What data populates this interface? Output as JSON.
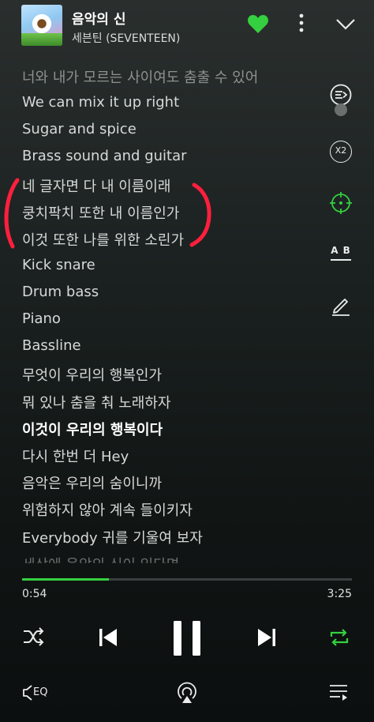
{
  "header": {
    "title": "음악의 신",
    "artist": "세븐틴 (SEVENTEEN)"
  },
  "lyrics": [
    {
      "text": "너와 내가 모르는 사이여도 춤출 수 있어",
      "state": "faded"
    },
    {
      "text": "We can mix it up right",
      "state": "normal"
    },
    {
      "text": "Sugar and spice",
      "state": "normal"
    },
    {
      "text": "Brass sound and guitar",
      "state": "normal"
    },
    {
      "text": "네 글자면 다 내 이름이래",
      "state": "normal"
    },
    {
      "text": "쿵치팍치 또한 내 이름인가",
      "state": "normal"
    },
    {
      "text": "이것 또한 나를 위한 소린가",
      "state": "normal"
    },
    {
      "text": "Kick snare",
      "state": "normal"
    },
    {
      "text": "Drum bass",
      "state": "normal"
    },
    {
      "text": "Piano",
      "state": "normal"
    },
    {
      "text": "Bassline",
      "state": "normal"
    },
    {
      "text": "무엇이 우리의 행복인가",
      "state": "normal"
    },
    {
      "text": "뭐 있나 춤을 춰 노래하자",
      "state": "normal"
    },
    {
      "text": "이것이 우리의 행복이다",
      "state": "active"
    },
    {
      "text": "다시 한번 더 Hey",
      "state": "normal"
    },
    {
      "text": "음악은 우리의 숨이니까",
      "state": "normal"
    },
    {
      "text": "위험하지 않아 계속 들이키자",
      "state": "normal"
    },
    {
      "text": "Everybody 귀를 기울여 보자",
      "state": "normal"
    },
    {
      "text": "세상에 음악의 신이 있다면",
      "state": "cut"
    }
  ],
  "side_tools": {
    "speed_label": "X2",
    "ab_label": "A B"
  },
  "playback": {
    "elapsed": "0:54",
    "duration": "3:25",
    "progress": 0.263
  },
  "bottom_bar": {
    "eq_label": "EQ"
  },
  "colors": {
    "accent": "#35d03f",
    "annotation": "#ff1f3d"
  },
  "icons": [
    "heart-icon",
    "more-vertical-icon",
    "chevron-down-icon",
    "skip-next-list-icon",
    "speed-x2-icon",
    "locate-target-icon",
    "ab-repeat-icon",
    "pen-icon",
    "shuffle-icon",
    "previous-icon",
    "pause-icon",
    "next-icon",
    "repeat-icon",
    "eq-icon",
    "airplay-icon",
    "playlist-icon"
  ]
}
